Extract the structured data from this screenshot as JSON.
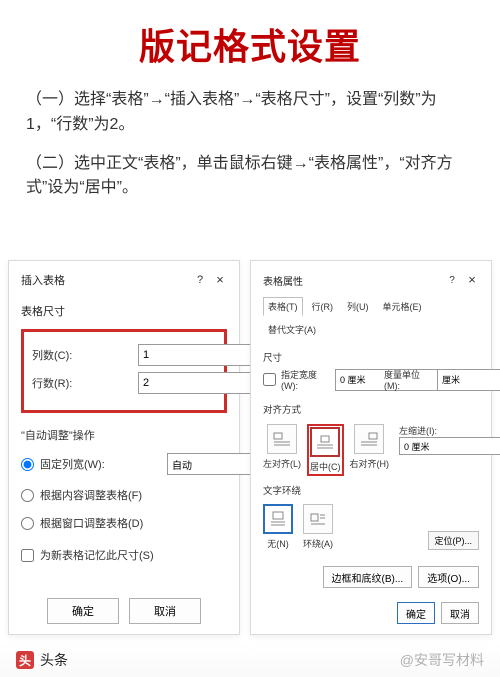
{
  "title": "版记格式设置",
  "instructions": {
    "p1": "（一）选择“表格”→“插入表格”→“表格尺寸”，设置“列数”为1，“行数”为2。",
    "p2": "（二）选中正文“表格”，单击鼠标右键→“表格属性”，“对齐方式”设为“居中”。"
  },
  "insert_dialog": {
    "title": "插入表格",
    "help": "?",
    "close": "×",
    "size_label": "表格尺寸",
    "cols_label": "列数(C):",
    "cols_value": "1",
    "rows_label": "行数(R):",
    "rows_value": "2",
    "auto_title": "\"自动调整\"操作",
    "fixed_label": "固定列宽(W):",
    "fixed_value": "自动",
    "fit_content": "根据内容调整表格(F)",
    "fit_window": "根据窗口调整表格(D)",
    "remember": "为新表格记忆此尺寸(S)",
    "ok": "确定",
    "cancel": "取消"
  },
  "props_dialog": {
    "title": "表格属性",
    "help": "?",
    "close": "×",
    "tabs": {
      "table": "表格(T)",
      "row": "行(R)",
      "col": "列(U)",
      "cell": "单元格(E)",
      "alt": "替代文字(A)"
    },
    "size_label": "尺寸",
    "pref_width": "指定宽度(W):",
    "pref_width_val": "0 厘米",
    "unit_label": "度量单位(M):",
    "unit_val": "厘米",
    "align_label": "对齐方式",
    "align_left": "左对齐(L)",
    "align_center": "居中(C)",
    "align_right": "右对齐(H)",
    "indent_label": "左缩进(I):",
    "indent_val": "0 厘米",
    "wrap_label": "文字环绕",
    "wrap_none": "无(N)",
    "wrap_around": "环绕(A)",
    "locate": "定位(P)...",
    "borders": "边框和底纹(B)...",
    "options": "选项(O)...",
    "ok": "确定",
    "cancel": "取消"
  },
  "footer": {
    "brand": "头条",
    "at": "@安哥写材料"
  }
}
